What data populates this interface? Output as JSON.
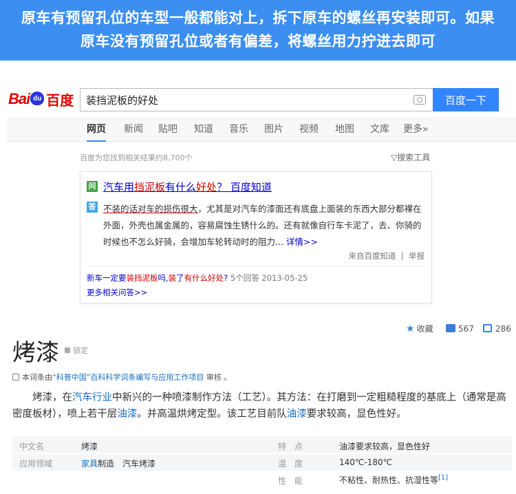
{
  "banner": {
    "line1": "原车有预留孔位的车型一般都能对上，拆下原车的螺丝再安装即可。如果",
    "line2": "原车没有预留孔位或者有偏差，将螺丝用力拧进去即可"
  },
  "header": {
    "logo_bai": "Bai",
    "logo_du": "du",
    "logo_cn": "百度",
    "search_value": "装挡泥板的好处",
    "search_button": "百度一下"
  },
  "tabs": [
    "网页",
    "新闻",
    "贴吧",
    "知道",
    "音乐",
    "图片",
    "视频",
    "地图",
    "文库",
    "更多»"
  ],
  "results": {
    "count_text": "百度为您找到相关结果约8,700个",
    "tools": "搜索工具"
  },
  "zhidao": {
    "q_badge": "问",
    "a_badge": "答",
    "title_parts": [
      "汽车用",
      "挡泥板",
      "有什么",
      "好处",
      "？ 百度知道"
    ],
    "answer_underlined": "不装的话对车的损伤很大",
    "answer_rest": "，尤其是对汽车的漆面还有底盘上面装的东西大部分都裸在外面，外壳也属金属的，容易腐蚀生锈什么的。还有就像自行车卡泥了，去、你骑的时候也不怎么好骑，会增加车轮转动时的阻力",
    "answer_more": "... 详情>>",
    "source": "来自百度知道",
    "report": "举报",
    "related_parts": [
      "新车一定要",
      "装挡泥板",
      "吗,",
      "装",
      "了",
      "有什么",
      "好处",
      "?"
    ],
    "related_meta": "5个回答 2013-05-25",
    "more_answers": "更多相关问答>>"
  },
  "baike": {
    "collect": "收藏",
    "likes": "567",
    "shares": "286",
    "title": "烤漆",
    "lock": "锁定",
    "note_prefix": "本词条由",
    "note_link": "“科普中国”百科科学词条编写与应用工作项目",
    "note_suffix": " 审核 。",
    "intro_1": "烤漆，在",
    "intro_link1": "汽车行业",
    "intro_2": "中新兴的一种喷漆制作方法（工艺）。其方法：在打磨到一定粗糙程度的基底上（通常是高密度板材），喷上若干层",
    "intro_link2": "油漆",
    "intro_3": "。并高温烘烤定型。该工艺目前队",
    "intro_link3": "油漆",
    "intro_4": "要求较高，显色性好。",
    "info": {
      "label_cn_name": "中文名",
      "value_cn_name": "烤漆",
      "label_feature": "特　点",
      "value_feature": "油漆要求较高，显色性好",
      "label_field": "应用领域",
      "value_field_link": "家具",
      "value_field_rest": "制造　汽车烤漆",
      "label_temp": "温　度",
      "value_temp": "140℃-180℃",
      "label_property": "性　能",
      "value_property": "不粘性、耐热性、抗湿性等",
      "ref": "[1]"
    }
  }
}
